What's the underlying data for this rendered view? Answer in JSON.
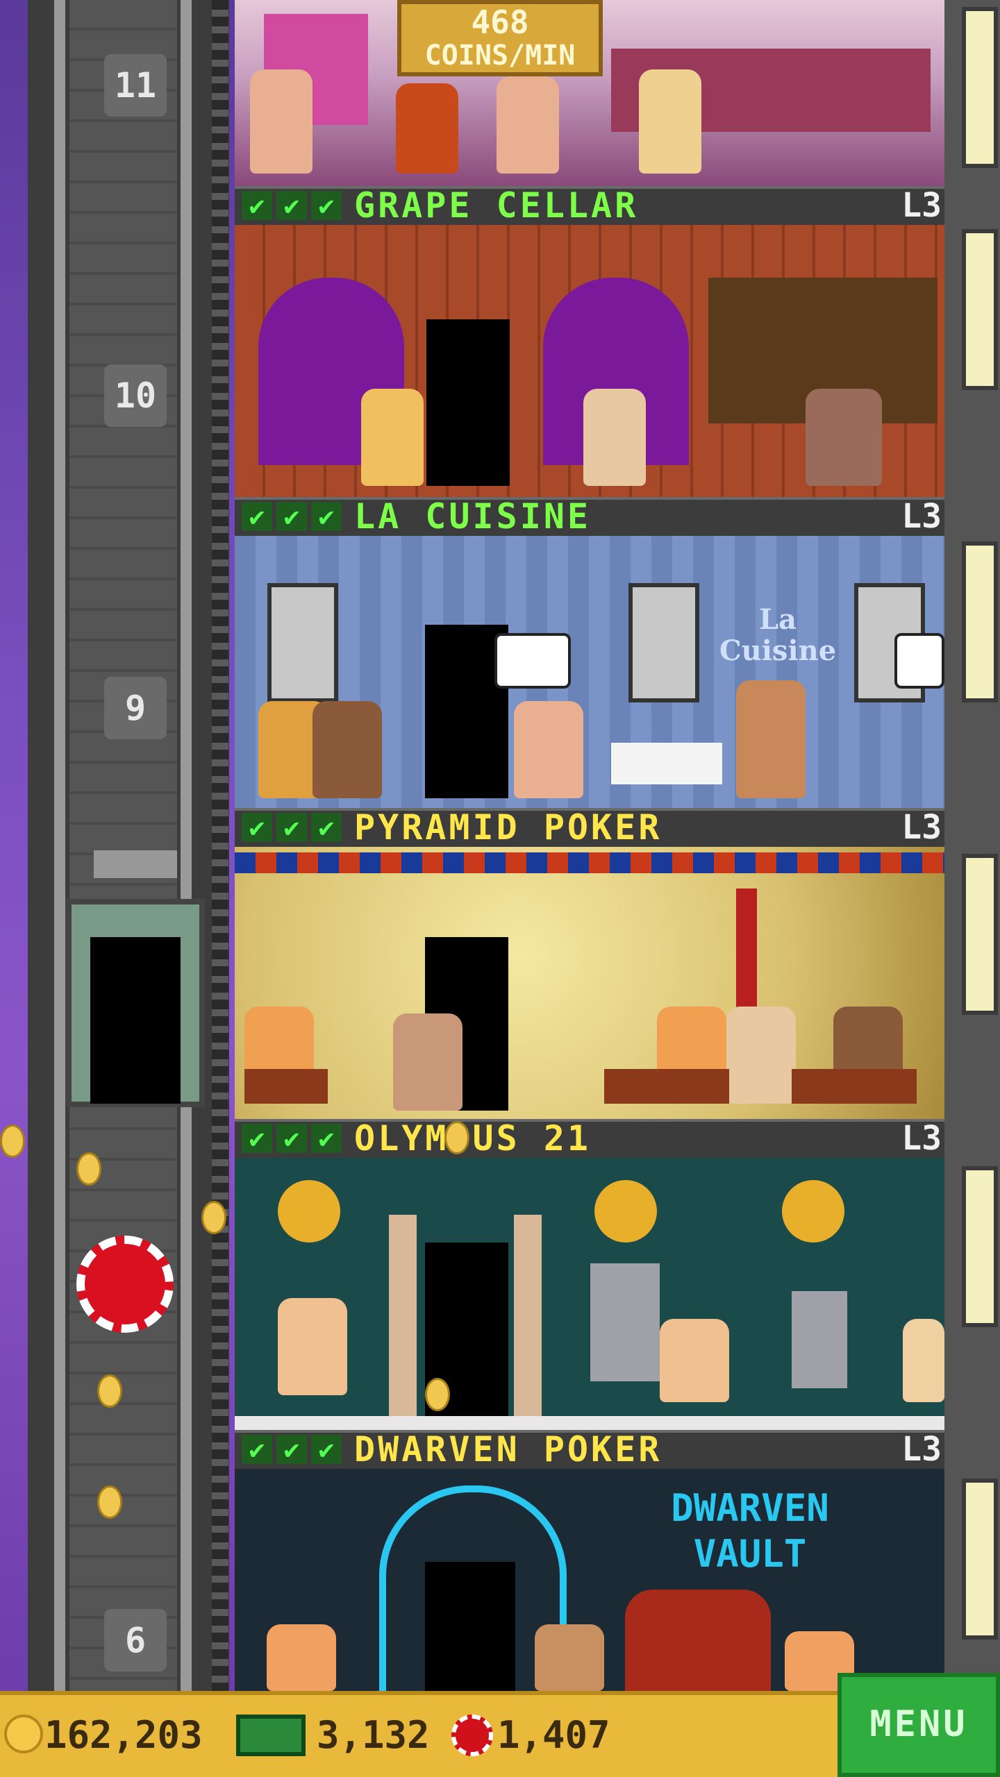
{
  "stats_badge": {
    "coins_per_min_value": "468",
    "coins_per_min_unit": "COINS/MIN"
  },
  "elevator": {
    "floor_labels": [
      "11",
      "10",
      "9",
      "6"
    ]
  },
  "floors": [
    {
      "name": "GRAPE CELLAR",
      "level": "L3",
      "checks": [
        "✔",
        "✔",
        "✔"
      ],
      "name_color": "#7dff4a"
    },
    {
      "name": "LA CUISINE",
      "level": "L3",
      "checks": [
        "✔",
        "✔",
        "✔"
      ],
      "name_color": "#7dff4a"
    },
    {
      "name": "PYRAMID POKER",
      "level": "L3",
      "checks": [
        "✔",
        "✔",
        "✔"
      ],
      "name_color": "#ffe64a"
    },
    {
      "name": "OLYMPUS 21",
      "level": "L3",
      "checks": [
        "✔",
        "✔",
        "✔"
      ],
      "name_color": "#ffe64a"
    },
    {
      "name": "DWARVEN POKER",
      "level": "L3",
      "checks": [
        "✔",
        "✔",
        "✔"
      ],
      "name_color": "#ffe64a"
    }
  ],
  "room_signs": {
    "la_cuisine_sign": "La Cuisine",
    "dwarven_sign_line1": "DWARVEN",
    "dwarven_sign_line2": "VAULT"
  },
  "currency": {
    "coins": "162,203",
    "bux": "3,132",
    "chips": "1,407"
  },
  "menu": {
    "label": "MENU"
  },
  "colors": {
    "bottom_bar": "#e8b93a",
    "menu_button": "#2fae3f",
    "check_green": "#52ff52",
    "casino_name_yellow": "#ffe64a",
    "food_name_green": "#7dff4a"
  },
  "icons": {
    "coin": "coin-icon",
    "bux": "bux-icon",
    "chip": "chip-icon"
  }
}
